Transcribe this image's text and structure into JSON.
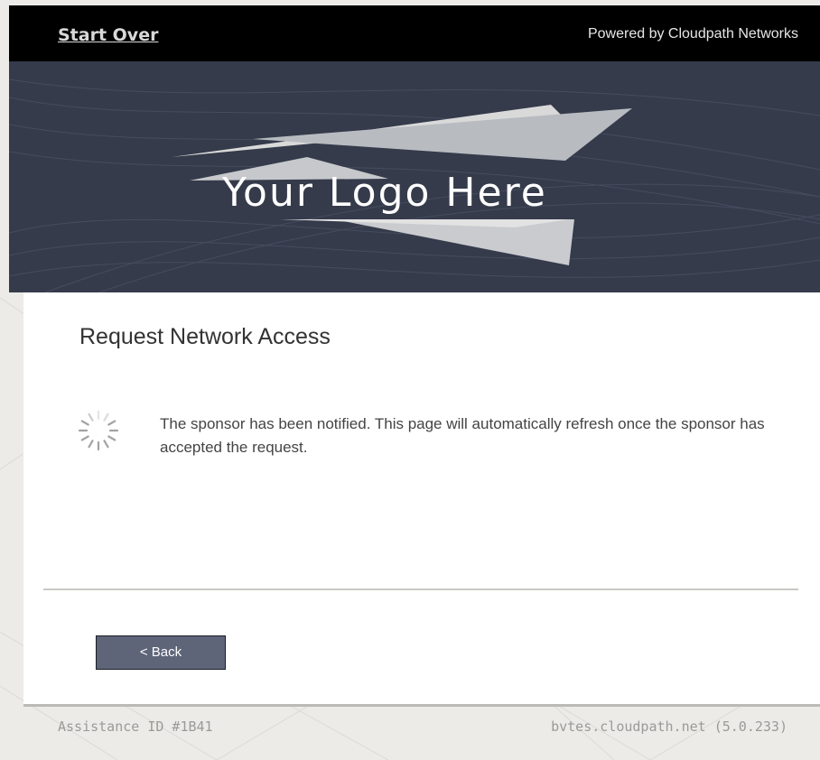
{
  "header": {
    "start_over_label": "Start Over",
    "powered_by": "Powered by Cloudpath Networks"
  },
  "banner": {
    "logo_text": "Your Logo Here",
    "logo_icon": "paper-plane-swoosh-icon"
  },
  "main": {
    "title": "Request Network Access",
    "status_icon": "loading-spinner-icon",
    "status_message": "The sponsor has been notified. This page will automatically refresh once the sponsor has accepted the request.",
    "back_label": "< Back"
  },
  "footer": {
    "assistance_id": "Assistance ID #1B41",
    "server_info": "bvtes.cloudpath.net (5.0.233)"
  },
  "colors": {
    "topbar": "#000000",
    "banner": "#353b4b",
    "button": "#5e6579",
    "page_background": "#ecebe8"
  }
}
